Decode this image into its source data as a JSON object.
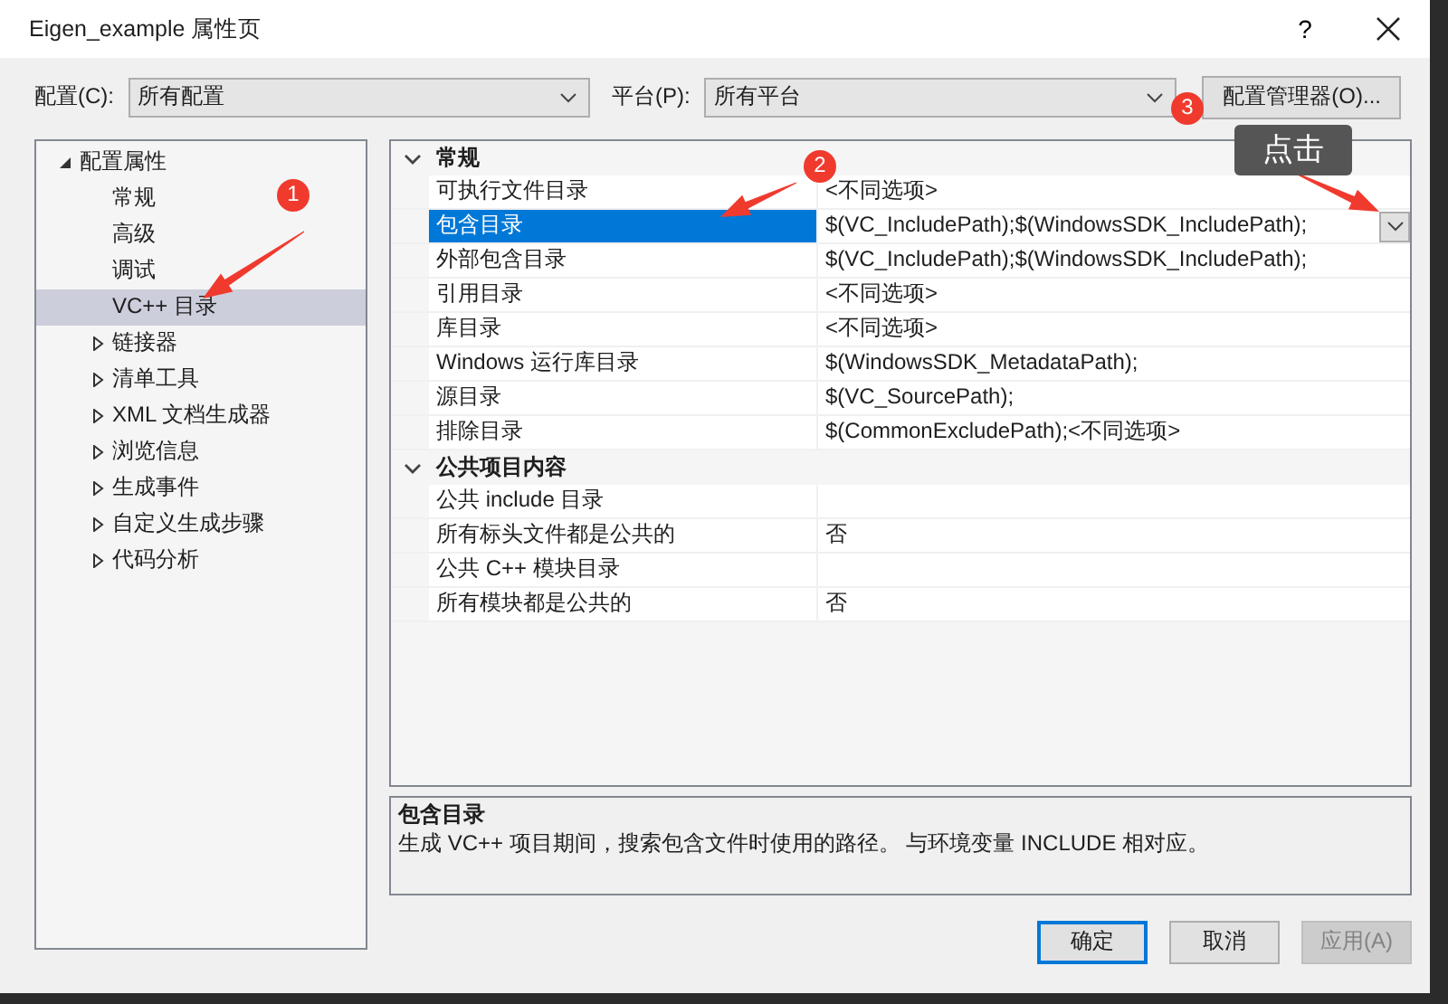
{
  "window": {
    "title": "Eigen_example 属性页",
    "help": "?"
  },
  "toolbar": {
    "config_label": "配置(C):",
    "config_value": "所有配置",
    "platform_label": "平台(P):",
    "platform_value": "所有平台",
    "manager_button": "配置管理器(O)..."
  },
  "tree": [
    {
      "label": "配置属性",
      "expanded": true,
      "children": [
        {
          "label": "常规",
          "selected": false
        },
        {
          "label": "高级",
          "selected": false
        },
        {
          "label": "调试",
          "selected": false
        },
        {
          "label": "VC++ 目录",
          "selected": true
        },
        {
          "label": "链接器",
          "selected": false,
          "expanded": false
        },
        {
          "label": "清单工具",
          "selected": false,
          "expanded": false
        },
        {
          "label": "XML 文档生成器",
          "selected": false,
          "expanded": false
        },
        {
          "label": "浏览信息",
          "selected": false,
          "expanded": false
        },
        {
          "label": "生成事件",
          "selected": false,
          "expanded": false
        },
        {
          "label": "自定义生成步骤",
          "selected": false,
          "expanded": false
        },
        {
          "label": "代码分析",
          "selected": false,
          "expanded": false
        }
      ]
    }
  ],
  "grid": {
    "categories": [
      {
        "title": "常规",
        "expanded": true,
        "properties": [
          {
            "name": "可执行文件目录",
            "value": "<不同选项>",
            "selected": false
          },
          {
            "name": "包含目录",
            "value": "$(VC_IncludePath);$(WindowsSDK_IncludePath);",
            "selected": true
          },
          {
            "name": "外部包含目录",
            "value": "$(VC_IncludePath);$(WindowsSDK_IncludePath);",
            "selected": false
          },
          {
            "name": "引用目录",
            "value": "<不同选项>",
            "selected": false
          },
          {
            "name": "库目录",
            "value": "<不同选项>",
            "selected": false
          },
          {
            "name": "Windows 运行库目录",
            "value": "$(WindowsSDK_MetadataPath);",
            "selected": false
          },
          {
            "name": "源目录",
            "value": "$(VC_SourcePath);",
            "selected": false
          },
          {
            "name": "排除目录",
            "value": "$(CommonExcludePath);<不同选项>",
            "selected": false
          }
        ]
      },
      {
        "title": "公共项目内容",
        "expanded": true,
        "properties": [
          {
            "name": "公共 include 目录",
            "selected": false
          },
          {
            "name": "所有标头文件都是公共的",
            "value": "否",
            "selected": false
          },
          {
            "name": "公共 C++ 模块目录",
            "selected": false
          },
          {
            "name": "所有模块都是公共的",
            "value": "否",
            "selected": false
          }
        ]
      }
    ]
  },
  "description": {
    "title": "包含目录",
    "text": "生成 VC++ 项目期间，搜索包含文件时使用的路径。  与环境变量 INCLUDE 相对应。"
  },
  "buttons": [
    {
      "label": "确定",
      "kind": "default",
      "disabled": false
    },
    {
      "label": "取消",
      "kind": "normal",
      "disabled": false
    },
    {
      "label": "应用(A)",
      "kind": "normal",
      "disabled": true
    }
  ],
  "annotations": {
    "badges": [
      "1",
      "2",
      "3"
    ],
    "tooltip": "点击"
  }
}
